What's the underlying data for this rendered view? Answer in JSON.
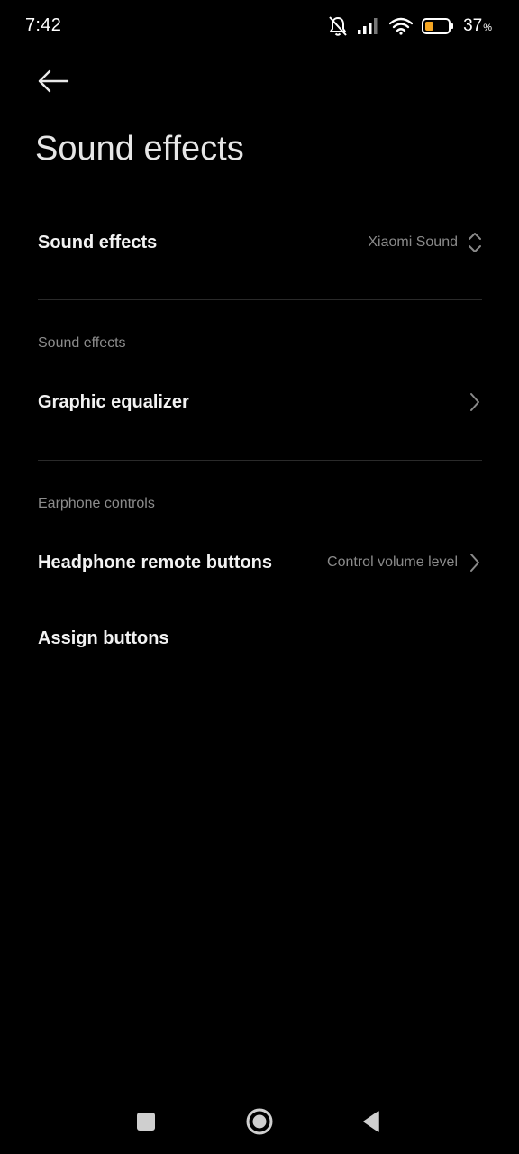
{
  "status_bar": {
    "time": "7:42",
    "battery_percent": "37",
    "battery_percent_sign": "%",
    "battery_level": 0.37,
    "battery_color": "#f5a623",
    "icons": [
      "bell-off-icon",
      "signal-icon",
      "wifi-icon",
      "battery-icon"
    ]
  },
  "header": {
    "back_icon": "arrow-left-icon",
    "title": "Sound effects"
  },
  "settings": {
    "sound_effects": {
      "title": "Sound effects",
      "value": "Xiaomi Sound",
      "icon": "up-down-chevron-icon"
    },
    "section_sound_effects": {
      "header": "Sound effects"
    },
    "graphic_equalizer": {
      "title": "Graphic equalizer",
      "icon": "chevron-right-icon"
    },
    "section_earphone_controls": {
      "header": "Earphone controls"
    },
    "headphone_remote_buttons": {
      "title": "Headphone remote buttons",
      "value": "Control volume level",
      "icon": "chevron-right-icon"
    },
    "assign_buttons": {
      "title": "Assign buttons"
    }
  },
  "nav_bar": {
    "icons": [
      "recents-square-icon",
      "home-circle-icon",
      "back-triangle-icon"
    ]
  },
  "colors": {
    "background": "#000000",
    "text_primary": "#f2f2f2",
    "text_secondary": "#8a8a8a",
    "divider": "#2a2a2a"
  }
}
